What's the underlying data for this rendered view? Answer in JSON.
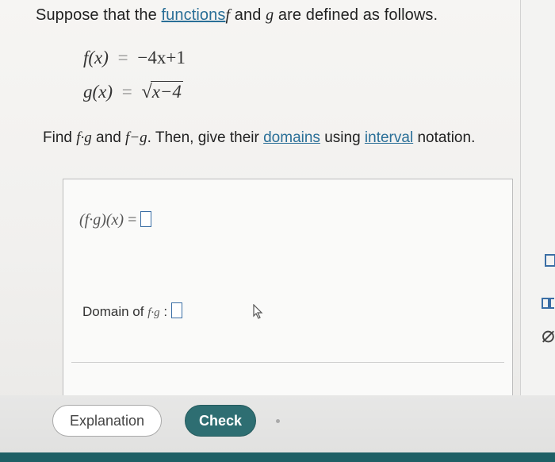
{
  "intro": {
    "prefix": "Suppose that the ",
    "link": "functions",
    "f": "f",
    "and": " and ",
    "g": "g",
    "suffix": " are defined as follows."
  },
  "equations": {
    "f_lhs": "f(x)",
    "eq": "=",
    "f_rhs": "−4x+1",
    "g_lhs": "g(x)",
    "g_rhs_radicand": "x−4",
    "sqrt_symbol": "√"
  },
  "task": {
    "find": "Find ",
    "fg": "f·g",
    "and": " and ",
    "fmg": "f−g",
    "then": ". Then, give their ",
    "domains_link": "domains",
    "using": " using ",
    "interval_link": "interval",
    "notation": " notation."
  },
  "answer_panel": {
    "row1_lhs": "(f·g)(x)",
    "row1_eq": "=",
    "domain_label": "Domain of ",
    "domain_fg": "f·g",
    "domain_colon": " :"
  },
  "side": {
    "glyph": "⌀"
  },
  "buttons": {
    "explanation": "Explanation",
    "check": "Check"
  },
  "colors": {
    "accent": "#2e6e72",
    "link": "#2a6f97",
    "input_border": "#3a6ea5"
  },
  "icons": [
    "cursor-arrow-icon",
    "answer-box-icon"
  ]
}
